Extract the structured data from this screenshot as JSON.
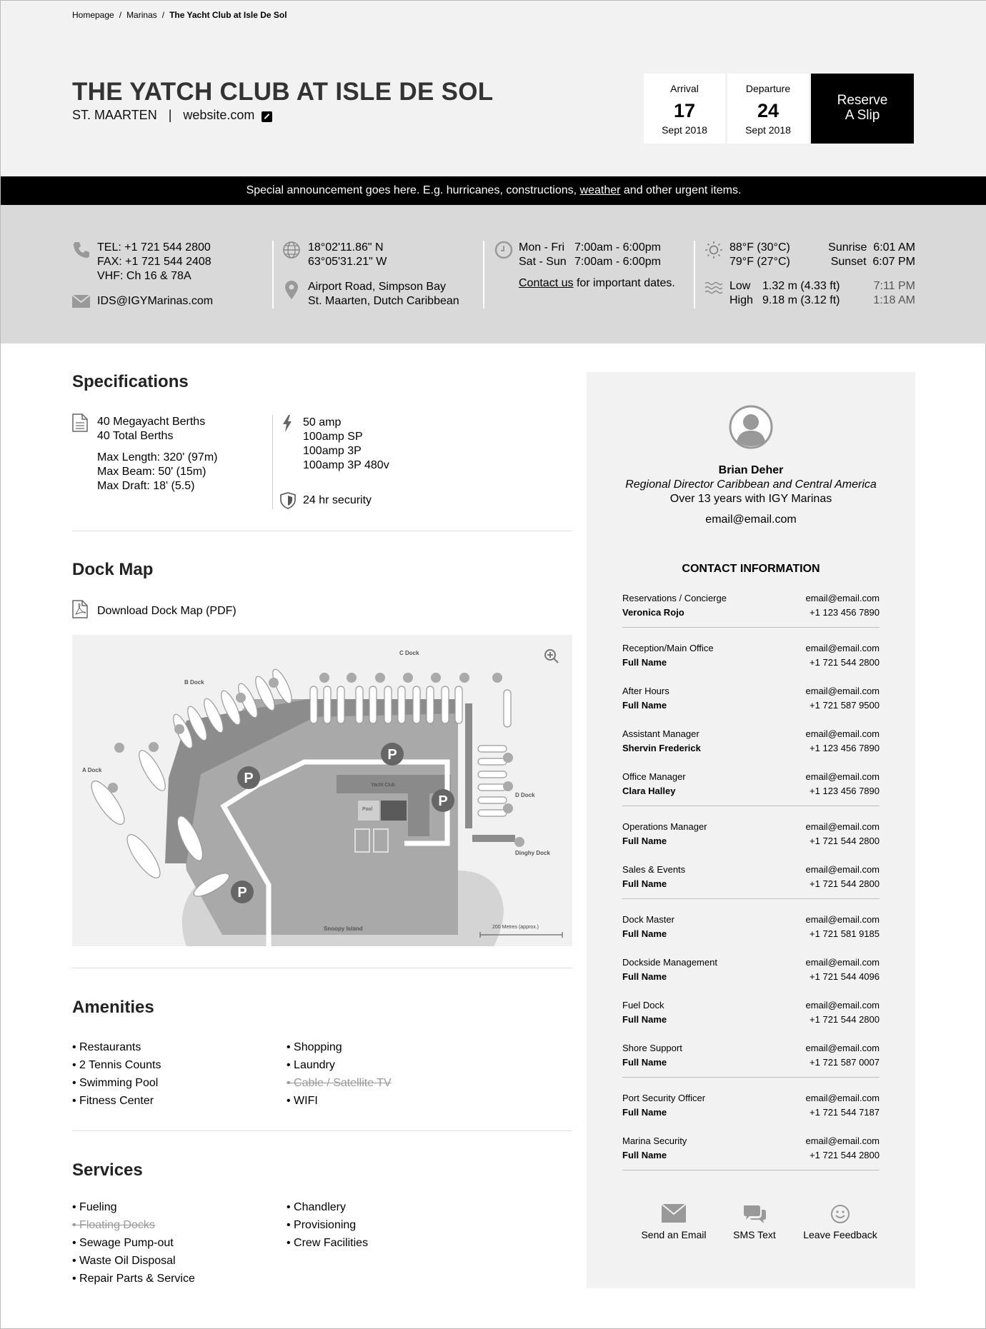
{
  "breadcrumb": {
    "home": "Homepage",
    "marinas": "Marinas",
    "current": "The Yacht Club at Isle De Sol"
  },
  "header": {
    "title": "THE YATCH CLUB AT ISLE DE SOL",
    "location": "ST. MAARTEN",
    "separator": "|",
    "website": "website.com"
  },
  "booking": {
    "arrival": {
      "label": "Arrival",
      "day": "17",
      "month": "Sept 2018"
    },
    "departure": {
      "label": "Departure",
      "day": "24",
      "month": "Sept 2018"
    },
    "reserve_line1": "Reserve",
    "reserve_line2": "A Slip"
  },
  "announcement": {
    "before": "Special announcement goes here. E.g. hurricanes, constructions,",
    "link": "weather",
    "after": "and other urgent items."
  },
  "info": {
    "tel": "TEL: +1 721 544 2800",
    "fax": "FAX: +1 721 544 2408",
    "vhf": "VHF: Ch 16 & 78A",
    "email": "IDS@IGYMarinas.com",
    "lat": "18°02'11.86\" N",
    "lon": "63°05'31.21\" W",
    "address1": "Airport Road, Simpson Bay",
    "address2": "St. Maarten, Dutch Caribbean",
    "hours1_days": "Mon - Fri",
    "hours1_time": "7:00am - 6:00pm",
    "hours2_days": "Sat - Sun",
    "hours2_time": "7:00am - 6:00pm",
    "contact_link": "Contact us",
    "contact_rest": "for important dates.",
    "temp_high": "88°F (30°C)",
    "temp_low": "79°F (27°C)",
    "sunrise_label": "Sunrise",
    "sunrise": "6:01 AM",
    "sunset_label": "Sunset",
    "sunset": "6:07 PM",
    "tide_low_label": "Low",
    "tide_low": "1.32 m (4.33 ft)",
    "tide_low_time": "7:11 PM",
    "tide_high_label": "High",
    "tide_high": "9.18 m (3.12 ft)",
    "tide_high_time": "1:18 AM"
  },
  "specs": {
    "title": "Specifications",
    "berths1": "40 Megayacht Berths",
    "berths2": "40 Total Berths",
    "length": "Max Length: 320' (97m)",
    "beam": "Max Beam: 50' (15m)",
    "draft": "Max Draft: 18' (5.5)",
    "power": [
      "50 amp",
      "100amp SP",
      "100amp 3P",
      "100amp 3P 480v"
    ],
    "security": "24 hr security"
  },
  "dockmap": {
    "title": "Dock Map",
    "download": "Download Dock Map (PDF)",
    "labels": {
      "c": "C Dock",
      "b": "B Dock",
      "a": "A Dock",
      "d": "D Dock",
      "dinghy": "Dinghy Dock",
      "snoopy": "Snoopy Island",
      "yacht": "Yacht Club",
      "pool": "Pool",
      "scale": "200 Metres (approx.)"
    }
  },
  "amenities": {
    "title": "Amenities",
    "left": [
      "• Restaurants",
      "• 2 Tennis Counts",
      "• Swimming Pool",
      "• Fitness Center"
    ],
    "right": [
      "• Shopping",
      "• Laundry",
      "• Cable / Satellite TV",
      "• WIFI"
    ]
  },
  "services": {
    "title": "Services",
    "left": [
      "• Fueling",
      "• Floating Docks",
      "• Sewage Pump-out",
      "• Waste Oil Disposal",
      "• Repair Parts & Service"
    ],
    "right": [
      "• Chandlery",
      "• Provisioning",
      "• Crew Facilities"
    ]
  },
  "manager": {
    "name": "Brian Deher",
    "role": "Regional Director Caribbean and Central America",
    "tenure": "Over 13 years with IGY Marinas",
    "email": "email@email.com"
  },
  "contact": {
    "title": "CONTACT INFORMATION",
    "rows": [
      {
        "role": "Reservations / Concierge",
        "name": "Veronica Rojo",
        "email": "email@email.com",
        "phone": "+1 123 456 7890"
      },
      {
        "role": "Reception/Main Office",
        "name": "Full Name",
        "email": "email@email.com",
        "phone": "+1 721 544 2800"
      },
      {
        "role": "After Hours",
        "name": "Full Name",
        "email": "email@email.com",
        "phone": "+1 721 587 9500"
      },
      {
        "role": "Assistant Manager",
        "name": "Shervin Frederick",
        "email": "email@email.com",
        "phone": "+1 123 456 7890"
      },
      {
        "role": "Office Manager",
        "name": "Clara Halley",
        "email": "email@email.com",
        "phone": "+1 123 456 7890"
      },
      {
        "role": "Operations Manager",
        "name": "Full Name",
        "email": "email@email.com",
        "phone": "+1 721 544 2800"
      },
      {
        "role": "Sales & Events",
        "name": "Full Name",
        "email": "email@email.com",
        "phone": "+1 721 544 2800"
      },
      {
        "role": "Dock Master",
        "name": "Full Name",
        "email": "email@email.com",
        "phone": "+1 721 581 9185"
      },
      {
        "role": "Dockside Management",
        "name": "Full Name",
        "email": "email@email.com",
        "phone": "+1 721 544 4096"
      },
      {
        "role": "Fuel Dock",
        "name": "Full Name",
        "email": "email@email.com",
        "phone": "+1 721 544 2800"
      },
      {
        "role": "Shore Support",
        "name": "Full Name",
        "email": "email@email.com",
        "phone": "+1 721 587 0007"
      },
      {
        "role": "Port Security Officer",
        "name": "Full Name",
        "email": "email@email.com",
        "phone": "+1 721 544 7187"
      },
      {
        "role": "Marina Security",
        "name": "Full Name",
        "email": "email@email.com",
        "phone": "+1 721 544 2800"
      }
    ]
  },
  "actions": {
    "email": "Send an Email",
    "sms": "SMS Text",
    "feedback": "Leave Feedback"
  }
}
